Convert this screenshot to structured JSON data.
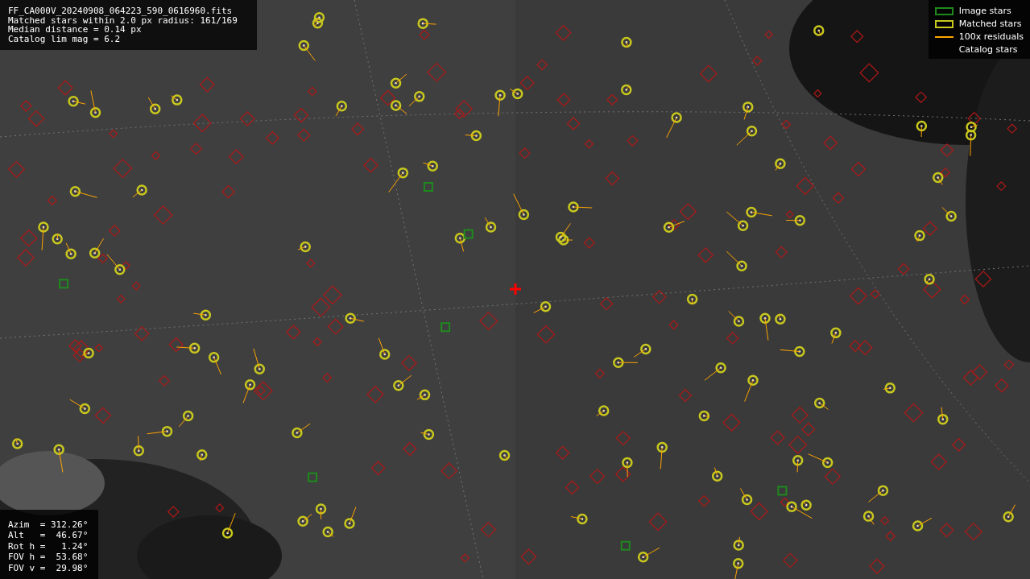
{
  "info_lines": [
    "FF_CA000V_20240908_064223_590_0616960.fits",
    "Matched stars within 2.0 px radius: 161/169",
    "Median distance = 0.14 px",
    "Catalog lim mag = 6.2"
  ],
  "legend": [
    {
      "kind": "box",
      "label": "Image stars",
      "color": "#1e8a1e"
    },
    {
      "kind": "box",
      "label": "Matched stars",
      "color": "#c8c81e"
    },
    {
      "kind": "line",
      "label": "100x residuals",
      "color": "#ffa500"
    },
    {
      "kind": "none",
      "label": "Catalog stars"
    }
  ],
  "pointing": [
    "Azim  = 312.26°",
    "Alt   =  46.67°",
    "Rot h =   1.24°",
    "FOV h =  53.68°",
    "FOV v =  29.98°"
  ]
}
